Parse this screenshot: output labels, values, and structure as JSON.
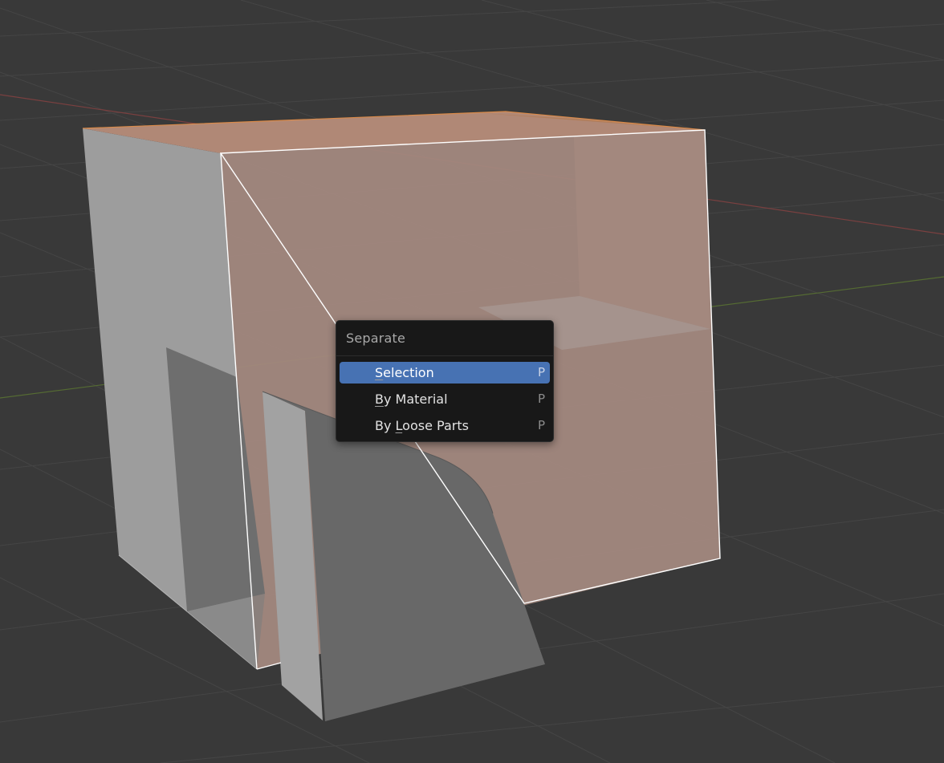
{
  "menu": {
    "title": "Separate",
    "items": [
      {
        "pre": "",
        "accel": "S",
        "post": "election",
        "shortcut": "P",
        "highlighted": true
      },
      {
        "pre": "",
        "accel": "B",
        "post": "y Material",
        "shortcut": "P",
        "highlighted": false
      },
      {
        "pre": "By ",
        "accel": "L",
        "post": "oose Parts",
        "shortcut": "P",
        "highlighted": false
      }
    ]
  },
  "viewport": {
    "background_color": "#393939",
    "grid_color": "#454545",
    "x_axis_color": "#7a4040",
    "y_axis_color": "#556b33",
    "selection_outline_color": "#ffffff",
    "selected_face_color": "#a58a80",
    "selected_top_color": "#c08a68",
    "unselected_face_color": "#9a9a9a",
    "highlight_color": "#4772b3"
  }
}
